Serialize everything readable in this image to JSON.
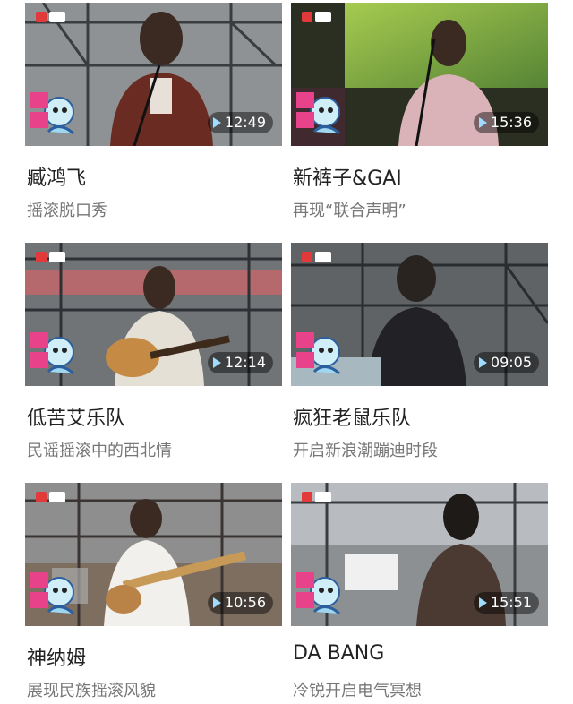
{
  "videos": [
    {
      "title": "臧鸿飞",
      "subtitle": "摇滚脱口秀",
      "duration": "12:49",
      "badge_icon": "zhai-shijiao-badge-icon",
      "bg": "#8b8f92"
    },
    {
      "title": "新裤子&GAI",
      "subtitle": "再现“联合声明”",
      "duration": "15:36",
      "badge_icon": "zhai-shijiao-badge-icon",
      "bg": "#2f3a24"
    },
    {
      "title": "低苦艾乐队",
      "subtitle": "民谣摇滚中的西北情",
      "duration": "12:14",
      "badge_icon": "zhai-shijiao-badge-icon",
      "bg": "#6c7072"
    },
    {
      "title": "疯狂老鼠乐队",
      "subtitle": "开启新浪潮蹦迪时段",
      "duration": "09:05",
      "badge_icon": "zhai-shijiao-badge-icon",
      "bg": "#5d6163"
    },
    {
      "title": "神纳姆",
      "subtitle": "展现民族摇滚风貌",
      "duration": "10:56",
      "badge_icon": "zhai-shijiao-badge-icon",
      "bg": "#7b6a5c"
    },
    {
      "title": "DA BANG",
      "subtitle": "冷锐开启电气冥想",
      "duration": "15:51",
      "badge_icon": "zhai-shijiao-badge-icon",
      "bg": "#8a8d90"
    }
  ]
}
